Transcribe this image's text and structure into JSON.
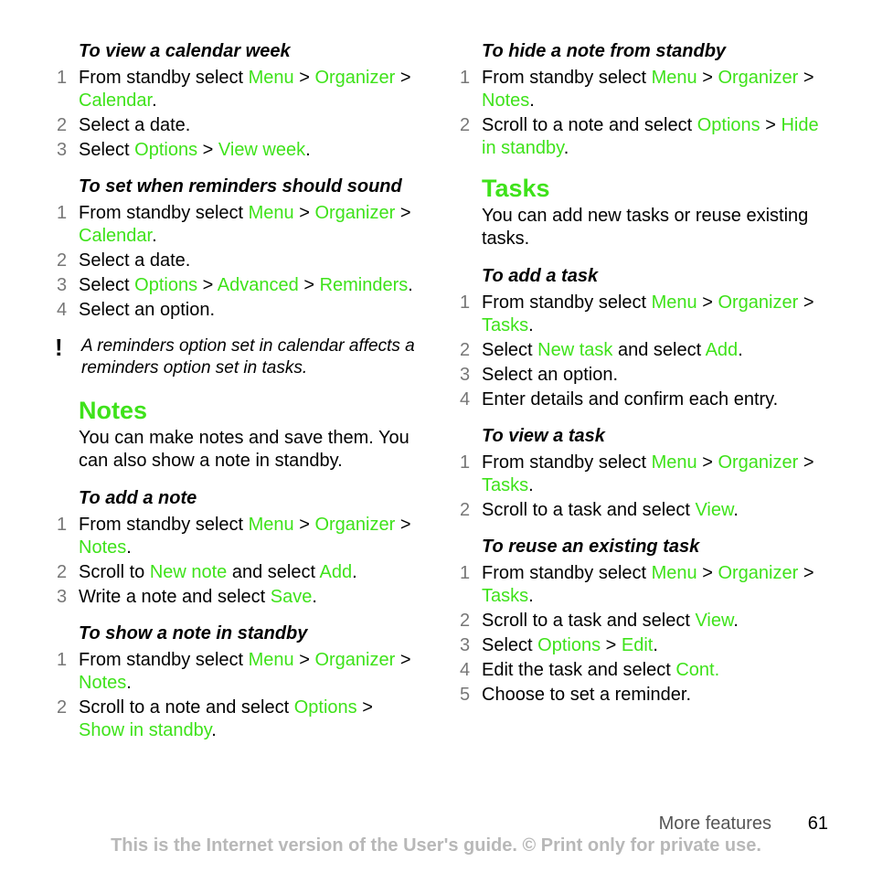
{
  "left": {
    "calendar_week": {
      "title": "To view a calendar week",
      "steps": [
        {
          "n": "1",
          "parts": [
            [
              "From standby select ",
              0
            ],
            [
              "Menu",
              1
            ],
            [
              " > ",
              0
            ],
            [
              "Organizer",
              1
            ],
            [
              " > ",
              0
            ],
            [
              "Calendar",
              1
            ],
            [
              ".",
              0
            ]
          ]
        },
        {
          "n": "2",
          "parts": [
            [
              "Select a date.",
              0
            ]
          ]
        },
        {
          "n": "3",
          "parts": [
            [
              "Select ",
              0
            ],
            [
              "Options",
              1
            ],
            [
              " > ",
              0
            ],
            [
              "View week",
              1
            ],
            [
              ".",
              0
            ]
          ]
        }
      ]
    },
    "reminders": {
      "title": "To set when reminders should sound",
      "steps": [
        {
          "n": "1",
          "parts": [
            [
              "From standby select ",
              0
            ],
            [
              "Menu",
              1
            ],
            [
              " > ",
              0
            ],
            [
              "Organizer",
              1
            ],
            [
              " > ",
              0
            ],
            [
              "Calendar",
              1
            ],
            [
              ".",
              0
            ]
          ]
        },
        {
          "n": "2",
          "parts": [
            [
              "Select a date.",
              0
            ]
          ]
        },
        {
          "n": "3",
          "parts": [
            [
              "Select ",
              0
            ],
            [
              "Options",
              1
            ],
            [
              " > ",
              0
            ],
            [
              "Advanced",
              1
            ],
            [
              " > ",
              0
            ],
            [
              "Reminders",
              1
            ],
            [
              ".",
              0
            ]
          ]
        },
        {
          "n": "4",
          "parts": [
            [
              "Select an option.",
              0
            ]
          ]
        }
      ]
    },
    "note_text": "A reminders option set in calendar affects a reminders option set in tasks.",
    "notes_heading": "Notes",
    "notes_intro": "You can make notes and save them. You can also show a note in standby.",
    "add_note": {
      "title": "To add a note",
      "steps": [
        {
          "n": "1",
          "parts": [
            [
              "From standby select ",
              0
            ],
            [
              "Menu",
              1
            ],
            [
              " > ",
              0
            ],
            [
              "Organizer",
              1
            ],
            [
              " > ",
              0
            ],
            [
              "Notes",
              1
            ],
            [
              ".",
              0
            ]
          ]
        },
        {
          "n": "2",
          "parts": [
            [
              "Scroll to ",
              0
            ],
            [
              "New note",
              1
            ],
            [
              " and select ",
              0
            ],
            [
              "Add",
              1
            ],
            [
              ".",
              0
            ]
          ]
        },
        {
          "n": "3",
          "parts": [
            [
              "Write a note and select ",
              0
            ],
            [
              "Save",
              1
            ],
            [
              ".",
              0
            ]
          ]
        }
      ]
    },
    "show_note": {
      "title": "To show a note in standby",
      "steps": [
        {
          "n": "1",
          "parts": [
            [
              "From standby select ",
              0
            ],
            [
              "Menu",
              1
            ],
            [
              " > ",
              0
            ],
            [
              "Organizer",
              1
            ],
            [
              " > ",
              0
            ],
            [
              "Notes",
              1
            ],
            [
              ".",
              0
            ]
          ]
        },
        {
          "n": "2",
          "parts": [
            [
              "Scroll to a note and select ",
              0
            ],
            [
              "Options",
              1
            ],
            [
              " > ",
              0
            ],
            [
              "Show in standby",
              1
            ],
            [
              ".",
              0
            ]
          ]
        }
      ]
    }
  },
  "right": {
    "hide_note": {
      "title": "To hide a note from standby",
      "steps": [
        {
          "n": "1",
          "parts": [
            [
              "From standby select ",
              0
            ],
            [
              "Menu",
              1
            ],
            [
              " > ",
              0
            ],
            [
              "Organizer",
              1
            ],
            [
              " > ",
              0
            ],
            [
              "Notes",
              1
            ],
            [
              ".",
              0
            ]
          ]
        },
        {
          "n": "2",
          "parts": [
            [
              "Scroll to a note and select ",
              0
            ],
            [
              "Options",
              1
            ],
            [
              " > ",
              0
            ],
            [
              "Hide in standby",
              1
            ],
            [
              ".",
              0
            ]
          ]
        }
      ]
    },
    "tasks_heading": "Tasks",
    "tasks_intro": "You can add new tasks or reuse existing tasks.",
    "add_task": {
      "title": "To add a task",
      "steps": [
        {
          "n": "1",
          "parts": [
            [
              "From standby select ",
              0
            ],
            [
              "Menu",
              1
            ],
            [
              " > ",
              0
            ],
            [
              "Organizer",
              1
            ],
            [
              " > ",
              0
            ],
            [
              "Tasks",
              1
            ],
            [
              ".",
              0
            ]
          ]
        },
        {
          "n": "2",
          "parts": [
            [
              "Select ",
              0
            ],
            [
              "New task",
              1
            ],
            [
              " and select ",
              0
            ],
            [
              "Add",
              1
            ],
            [
              ".",
              0
            ]
          ]
        },
        {
          "n": "3",
          "parts": [
            [
              "Select an option.",
              0
            ]
          ]
        },
        {
          "n": "4",
          "parts": [
            [
              "Enter details and confirm each entry.",
              0
            ]
          ]
        }
      ]
    },
    "view_task": {
      "title": "To view a task",
      "steps": [
        {
          "n": "1",
          "parts": [
            [
              "From standby select ",
              0
            ],
            [
              "Menu",
              1
            ],
            [
              " > ",
              0
            ],
            [
              "Organizer",
              1
            ],
            [
              " > ",
              0
            ],
            [
              "Tasks",
              1
            ],
            [
              ".",
              0
            ]
          ]
        },
        {
          "n": "2",
          "parts": [
            [
              "Scroll to a task and select ",
              0
            ],
            [
              "View",
              1
            ],
            [
              ".",
              0
            ]
          ]
        }
      ]
    },
    "reuse_task": {
      "title": "To reuse an existing task",
      "steps": [
        {
          "n": "1",
          "parts": [
            [
              "From standby select ",
              0
            ],
            [
              "Menu",
              1
            ],
            [
              " > ",
              0
            ],
            [
              "Organizer",
              1
            ],
            [
              " > ",
              0
            ],
            [
              "Tasks",
              1
            ],
            [
              ".",
              0
            ]
          ]
        },
        {
          "n": "2",
          "parts": [
            [
              "Scroll to a task and select ",
              0
            ],
            [
              "View",
              1
            ],
            [
              ".",
              0
            ]
          ]
        },
        {
          "n": "3",
          "parts": [
            [
              "Select ",
              0
            ],
            [
              "Options",
              1
            ],
            [
              " > ",
              0
            ],
            [
              "Edit",
              1
            ],
            [
              ".",
              0
            ]
          ]
        },
        {
          "n": "4",
          "parts": [
            [
              "Edit the task and select ",
              0
            ],
            [
              "Cont.",
              1
            ]
          ]
        },
        {
          "n": "5",
          "parts": [
            [
              "Choose to set a reminder.",
              0
            ]
          ]
        }
      ]
    }
  },
  "footer": {
    "section": "More features",
    "page": "61",
    "notice": "This is the Internet version of the User's guide. © Print only for private use."
  },
  "colors": {
    "accent": "#3ee21a",
    "step_number": "#777777",
    "notice": "#b8b8b8"
  }
}
